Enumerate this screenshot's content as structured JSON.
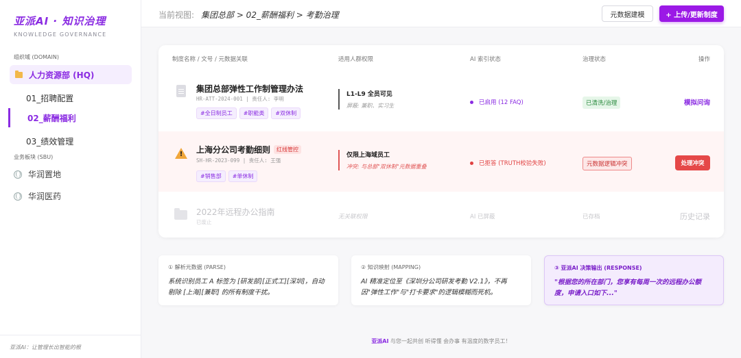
{
  "sidebar": {
    "brand": "亚派AI · 知识治理",
    "brand_sub": "KNOWLEDGE GOVERNANCE",
    "domain_label": "组织域 (DOMAIN)",
    "domain_item": "人力资源部 (HQ)",
    "sub_items": [
      "01_招聘配置",
      "02_薪酬福利",
      "03_绩效管理"
    ],
    "sbu_label": "业务板块 (SBU)",
    "sbu_items": [
      "华润置地",
      "华润医药"
    ],
    "footer": "亚派AI：让管理长出智能的根"
  },
  "topbar": {
    "view_label": "当前视图:",
    "breadcrumb": "集团总部 > 02_薪酬福利 > 考勤治理",
    "meta_button": "元数据建模",
    "upload_button": "+ 上传/更新制度"
  },
  "table": {
    "headers": [
      "制度名称 / 文号 / 元数据关联",
      "适用人群权限",
      "AI 索引状态",
      "治理状态",
      "操作"
    ],
    "rows": [
      {
        "title": "集团总部弹性工作制管理办法",
        "meta": "HR-ATT-2024-001 | 责任人: 李明",
        "tags": [
          "#全日制员工",
          "#职能类",
          "#双休制"
        ],
        "perm_main": "L1-L9 全员可见",
        "perm_sub": "屏蔽: 兼职、实习生",
        "ai_status": "已启用 (12 FAQ)",
        "gov_status": "已清洗/治理",
        "action": "模拟问询"
      },
      {
        "title": "上海分公司考勤细则",
        "badge": "红线管控",
        "meta": "SH-HR-2023-099 | 责任人: 王强",
        "tags": [
          "#销售部",
          "#单休制"
        ],
        "perm_main": "仅限上海域员工",
        "perm_sub": "冲突: 与总部\"双休制\"元数据重叠",
        "ai_status": "已拒答 (TRUTH校验失败)",
        "gov_status": "元数据逻辑冲突",
        "action": "处理冲突"
      },
      {
        "title": "2022年远程办公指南",
        "meta": "已废止",
        "perm_main": "无关联权限",
        "ai_status": "AI 已屏蔽",
        "gov_status": "已存档",
        "action": "历史记录"
      }
    ]
  },
  "panels": [
    {
      "header": "① 解析元数据 (PARSE)",
      "body": "系统识别员工 A 标签为 [研发部][正式工][深圳]，自动剔除 [上海][兼职] 的所有制度干扰。"
    },
    {
      "header": "② 知识映射 (MAPPING)",
      "body": "AI 精准定位至《深圳分公司研发考勤 V2.1》，不再因\"弹性工作\"与\"打卡要求\"的逻辑模糊而死机。"
    },
    {
      "header": "③ 亚派AI 决策输出 (RESPONSE)",
      "body": "\"根据您的所在部门，您享有每周一次的远程办公额度，申请入口如下...\""
    }
  ],
  "footer": {
    "brand": "亚派AI",
    "slogan": "与您一起共创 听得懂 会办事 有温度的数字员工！"
  },
  "colors": {
    "accent": "#8a2be2",
    "danger": "#e54848",
    "success": "#2a8a3e"
  }
}
